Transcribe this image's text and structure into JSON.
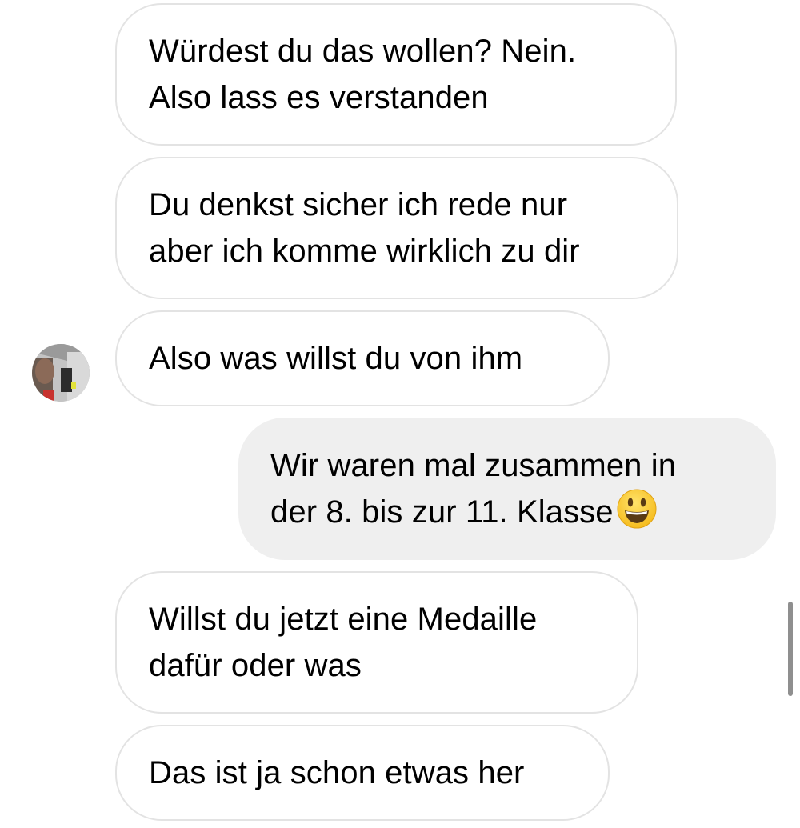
{
  "messages": [
    {
      "id": "b1",
      "direction": "received",
      "text": "Würdest du das wollen? Nein.\nAlso lass es verstanden"
    },
    {
      "id": "b2",
      "direction": "received",
      "text": "Du denkst sicher ich rede nur\naber ich komme wirklich zu dir"
    },
    {
      "id": "b3",
      "direction": "received",
      "text": "Also was willst du von ihm",
      "show_avatar": true
    },
    {
      "id": "b4",
      "direction": "sent",
      "text_line1": "Wir waren mal zusammen in",
      "text_line2": "der 8. bis zur 11. Klasse",
      "emoji": "smiley-emoji"
    },
    {
      "id": "b5",
      "direction": "received",
      "text": "Willst du jetzt eine Medaille\ndafür oder was"
    },
    {
      "id": "b6",
      "direction": "received",
      "text": "Das ist ja schon etwas her"
    }
  ],
  "avatar": {
    "icon": "contact-avatar"
  },
  "colors": {
    "received_bg": "#ffffff",
    "received_border": "#e3e3e3",
    "sent_bg": "#efefef",
    "text": "#000000",
    "scrollbar": "#8f8f8f"
  }
}
